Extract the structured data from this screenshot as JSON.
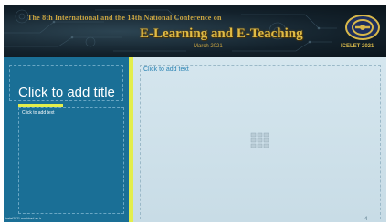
{
  "banner": {
    "conference_line": "The 8th International and the 14th National Conference on",
    "title": "E-Learning and E-Teaching",
    "date": "March 2021",
    "logo_text": "ICELET 2021"
  },
  "left_panel": {
    "title_placeholder": "Click to add title",
    "text_placeholder": "Click to add text",
    "footer_url": "icelet2021.mashhad.ac.ir"
  },
  "right_panel": {
    "text_placeholder": "Click to add text"
  },
  "page_number": "4",
  "colors": {
    "left_panel": "#1a6f96",
    "accent_stripe": "#e3ee4c",
    "right_panel": "#d5e6ee",
    "banner_gold": "#e0bb45"
  },
  "icons": {
    "content_insert": "insert-content-icon",
    "logo": "conference-logo-icon"
  }
}
